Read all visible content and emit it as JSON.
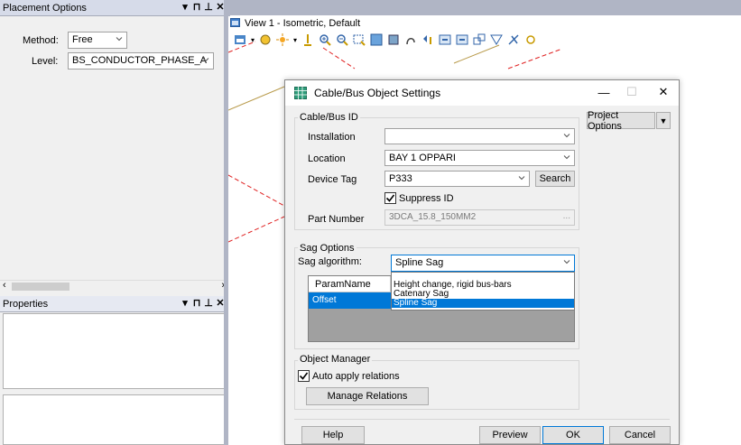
{
  "placement_panel": {
    "title": "Placement Options",
    "method_label": "Method:",
    "method_value": "Free",
    "level_label": "Level:",
    "level_value": "BS_CONDUCTOR_PHASE_A"
  },
  "properties_panel": {
    "title": "Properties"
  },
  "view": {
    "tab_title": "View 1 - Isometric, Default"
  },
  "dialog": {
    "title": "Cable/Bus Object Settings",
    "project_options_label": "Project Options",
    "cable_bus_id": {
      "group_label": "Cable/Bus ID",
      "installation_label": "Installation",
      "installation_value": "",
      "location_label": "Location",
      "location_value": "BAY 1 OPPARI",
      "device_tag_label": "Device Tag",
      "device_tag_value": "P333",
      "search_label": "Search",
      "suppress_id_label": "Suppress ID",
      "part_number_label": "Part Number",
      "part_number_value": "3DCA_15.8_150MM2",
      "part_number_ellipsis": "..."
    },
    "sag_options": {
      "group_label": "Sag Options",
      "algorithm_label": "Sag algorithm:",
      "algorithm_value": "Spline Sag",
      "options": [
        "Height change, rigid bus-bars",
        "Catenary Sag",
        "Spline Sag"
      ],
      "param_header": "ParamName",
      "param_row": "Offset"
    },
    "object_manager": {
      "group_label": "Object Manager",
      "auto_apply_label": "Auto apply relations",
      "manage_relations_label": "Manage Relations"
    },
    "buttons": {
      "help": "Help",
      "preview": "Preview",
      "ok": "OK",
      "cancel": "Cancel"
    }
  },
  "colors": {
    "dock_title_bg": "#d6dbe9",
    "selection_blue": "#0078d7",
    "app_frame": "#b0b5c5",
    "dashed_line": "#e02020"
  }
}
